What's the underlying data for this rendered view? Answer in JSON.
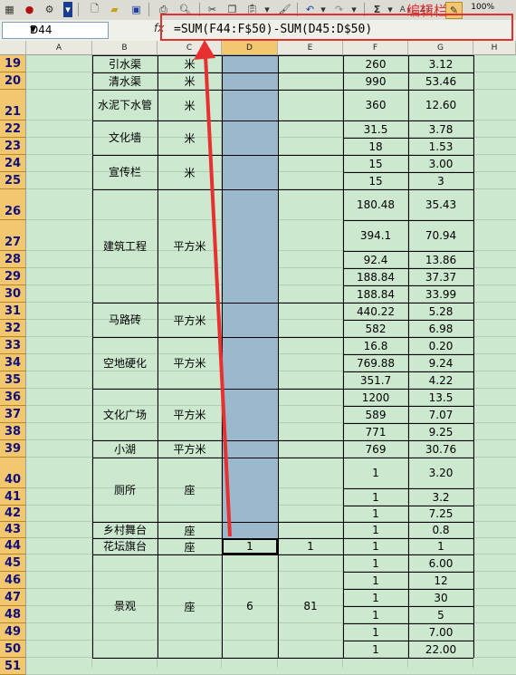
{
  "name_box": "D44",
  "fx_label": "fx",
  "formula": "=SUM(F44:F$50)-SUM(D45:D$50)",
  "annotation": "编辑栏",
  "zoom": "100%",
  "columns": [
    "A",
    "B",
    "C",
    "D",
    "E",
    "F",
    "G",
    "H"
  ],
  "rows": [
    {
      "num": "19",
      "f": "260",
      "g": "3.12"
    },
    {
      "num": "20",
      "f": "990",
      "g": "53.46"
    },
    {
      "num": "21",
      "f": "360",
      "g": "12.60"
    },
    {
      "num": "22",
      "f": "31.5",
      "g": "3.78"
    },
    {
      "num": "23",
      "f": "18",
      "g": "1.53"
    },
    {
      "num": "24",
      "f": "15",
      "g": "3.00"
    },
    {
      "num": "25",
      "f": "15",
      "g": "3"
    },
    {
      "num": "26",
      "f": "180.48",
      "g": "35.43"
    },
    {
      "num": "27",
      "f": "394.1",
      "g": "70.94"
    },
    {
      "num": "28",
      "f": "92.4",
      "g": "13.86"
    },
    {
      "num": "29",
      "f": "188.84",
      "g": "37.37"
    },
    {
      "num": "30",
      "f": "188.84",
      "g": "33.99"
    },
    {
      "num": "31",
      "f": "440.22",
      "g": "5.28"
    },
    {
      "num": "32",
      "f": "582",
      "g": "6.98"
    },
    {
      "num": "33",
      "f": "16.8",
      "g": "0.20"
    },
    {
      "num": "34",
      "f": "769.88",
      "g": "9.24"
    },
    {
      "num": "35",
      "f": "351.7",
      "g": "4.22"
    },
    {
      "num": "36",
      "f": "1200",
      "g": "13.5"
    },
    {
      "num": "37",
      "f": "589",
      "g": "7.07"
    },
    {
      "num": "38",
      "f": "771",
      "g": "9.25"
    },
    {
      "num": "39",
      "f": "769",
      "g": "30.76"
    },
    {
      "num": "40",
      "f": "1",
      "g": "3.20"
    },
    {
      "num": "41",
      "f": "1",
      "g": "3.2"
    },
    {
      "num": "42",
      "f": "1",
      "g": "7.25"
    },
    {
      "num": "43",
      "f": "1",
      "g": "0.8"
    },
    {
      "num": "44",
      "f": "1",
      "g": "1"
    },
    {
      "num": "45",
      "f": "1",
      "g": "6.00"
    },
    {
      "num": "46",
      "f": "1",
      "g": "12"
    },
    {
      "num": "47",
      "f": "1",
      "g": "30"
    },
    {
      "num": "48",
      "f": "1",
      "g": "5"
    },
    {
      "num": "49",
      "f": "1",
      "g": "7.00"
    },
    {
      "num": "50",
      "f": "1",
      "g": "22.00"
    },
    {
      "num": "51",
      "f": "",
      "g": ""
    }
  ],
  "groups": [
    {
      "b": "引水渠",
      "c": "米"
    },
    {
      "b": "清水渠",
      "c": "米"
    },
    {
      "b": "水泥下水管",
      "c": "米"
    },
    {
      "b": "文化墙",
      "c": "米"
    },
    {
      "b": "宣传栏",
      "c": "米"
    },
    {
      "b": "建筑工程",
      "c": "平方米"
    },
    {
      "b": "马路砖",
      "c": "平方米"
    },
    {
      "b": "空地硬化",
      "c": "平方米"
    },
    {
      "b": "文化广场",
      "c": "平方米"
    },
    {
      "b": "小湖",
      "c": "平方米"
    },
    {
      "b": "厕所",
      "c": "座"
    },
    {
      "b": "乡村舞台",
      "c": "座"
    },
    {
      "b": "花坛旗台",
      "c": "座",
      "d": "1",
      "e": "1"
    },
    {
      "b": "景观",
      "c": "座",
      "d": "6",
      "e": "81"
    }
  ]
}
